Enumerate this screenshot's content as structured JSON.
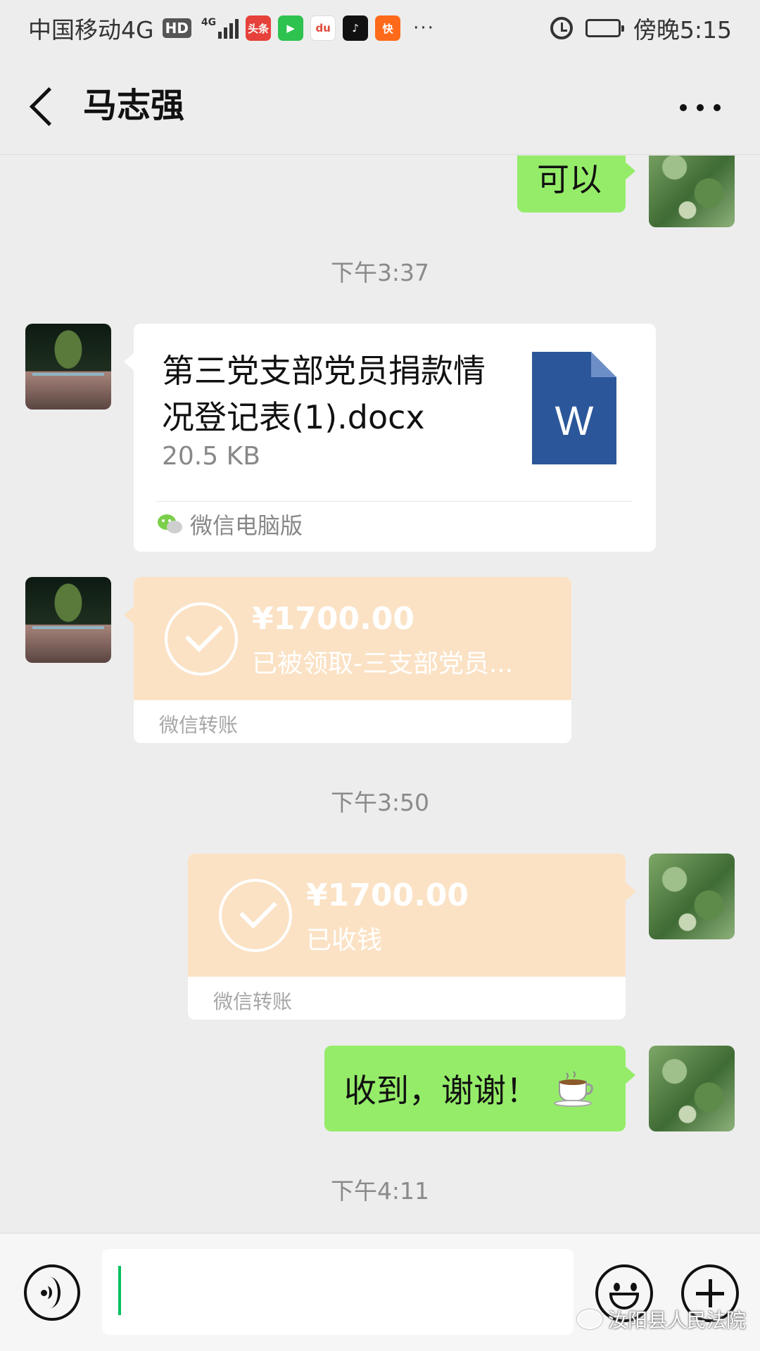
{
  "status_bar": {
    "carrier": "中国移动4G",
    "hd": "HD",
    "network": "4G",
    "time": "傍晚5:15",
    "more": "···",
    "apps": [
      {
        "name": "toutiao-icon",
        "label": "头条",
        "color": "#e6413a"
      },
      {
        "name": "video-icon",
        "label": "▶",
        "color": "#2ec24f"
      },
      {
        "name": "baidu-map-icon",
        "label": "du",
        "color": "#e04b3b"
      },
      {
        "name": "tiktok-icon",
        "label": "♪",
        "color": "#111111"
      },
      {
        "name": "kuaishou-icon",
        "label": "快",
        "color": "#ff6a1a"
      }
    ]
  },
  "header": {
    "title": "马志强"
  },
  "messages": {
    "msg1": {
      "text": "可以"
    },
    "time1": "下午3:37",
    "file": {
      "name": "第三党支部党员捐款情况登记表(1).docx",
      "size": "20.5 KB",
      "source": "微信电脑版",
      "icon_letter": "W"
    },
    "transfer1": {
      "amount": "¥1700.00",
      "status": "已被领取-三支部党员...",
      "label": "微信转账"
    },
    "time2": "下午3:50",
    "transfer2": {
      "amount": "¥1700.00",
      "status": "已收钱",
      "label": "微信转账"
    },
    "msg2": {
      "text": "收到，谢谢！"
    },
    "time3": "下午4:11"
  },
  "input_bar": {
    "value": ""
  },
  "watermark": "汝阳县人民法院",
  "colors": {
    "background": "#ededed",
    "bubble_green": "#95ec69",
    "transfer_orange": "#fbe2c5",
    "word_blue": "#2b579a",
    "cursor_green": "#07c160"
  }
}
